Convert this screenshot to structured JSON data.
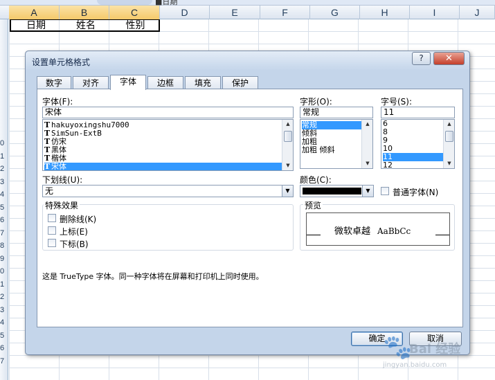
{
  "sheet": {
    "top_snippet": "■日期",
    "columns": [
      "A",
      "B",
      "C",
      "D",
      "E",
      "F",
      "G",
      "H",
      "I",
      "J"
    ],
    "row_numbers": [
      "0",
      "1",
      "2",
      "3",
      "4",
      "5",
      "6",
      "7",
      "8",
      "9",
      "0",
      "1",
      "2",
      "3",
      "4",
      "5",
      "6",
      "7"
    ],
    "cells": [
      "日期",
      "姓名",
      "性别"
    ]
  },
  "dialog": {
    "title": "设置单元格格式",
    "help_label": "?",
    "close_label": "✕",
    "tabs": [
      "数字",
      "对齐",
      "字体",
      "边框",
      "填充",
      "保护"
    ],
    "active_tab": "字体",
    "font": {
      "label": "字体(F):",
      "value": "宋体",
      "list": [
        "hakuyoxingshu7000",
        "SimSun-ExtB",
        "仿宋",
        "黑体",
        "楷体",
        "宋体"
      ],
      "selected": "宋体"
    },
    "style": {
      "label": "字形(O):",
      "value": "常规",
      "list": [
        "常规",
        "倾斜",
        "加粗",
        "加粗 倾斜"
      ],
      "selected": "常规"
    },
    "size": {
      "label": "字号(S):",
      "value": "11",
      "list": [
        "6",
        "8",
        "9",
        "10",
        "11",
        "12"
      ],
      "selected": "11"
    },
    "underline": {
      "label": "下划线(U):",
      "value": "无"
    },
    "color": {
      "label": "颜色(C):",
      "value": "#000000"
    },
    "normal_font": {
      "label": "普通字体(N)",
      "checked": false
    },
    "effects": {
      "title": "特殊效果",
      "items": [
        "删除线(K)",
        "上标(E)",
        "下标(B)"
      ]
    },
    "preview": {
      "title": "预览",
      "cjk_text": "微软卓越",
      "latin_text": "AaBbCc"
    },
    "description": "这是 TrueType 字体。同一种字体将在屏幕和打印机上同时使用。",
    "buttons": {
      "ok": "确定",
      "cancel": "取消"
    }
  },
  "watermark": {
    "text": "Bai 经验",
    "url": "jingyan.baidu.com"
  },
  "colors": {
    "selection": "#3399ff",
    "dialog_bg": "#c4d5ea",
    "close_button": "#c5402b"
  }
}
